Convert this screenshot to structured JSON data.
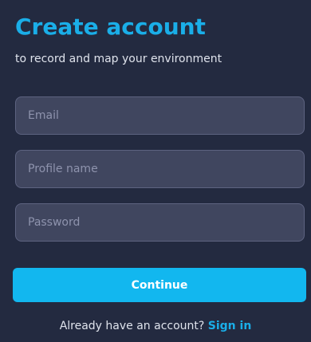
{
  "header": {
    "title": "Create account",
    "subtitle": "to record and map your environment"
  },
  "form": {
    "email_placeholder": "Email",
    "profile_placeholder": "Profile name",
    "password_placeholder": "Password",
    "continue_label": "Continue"
  },
  "footer": {
    "prompt": "Already have an account?",
    "signin_label": "Sign in"
  },
  "colors": {
    "background": "#232a40",
    "accent": "#1aaee8",
    "button": "#12b7ef",
    "field_background": "#40465f",
    "field_border": "#5d6380"
  }
}
